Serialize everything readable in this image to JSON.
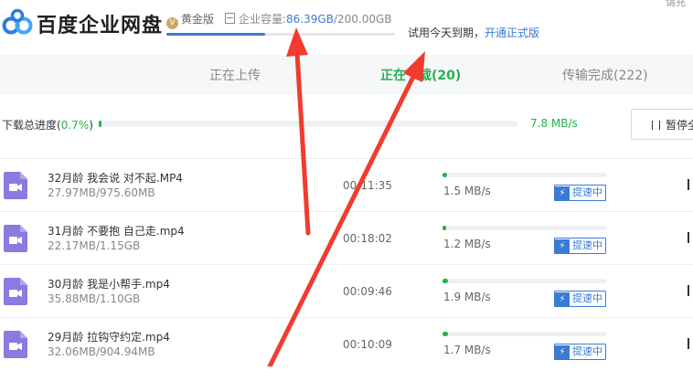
{
  "header": {
    "logo_text": "百度企业网盘",
    "plan_label": "黄金版",
    "storage_label": "企业容量:",
    "storage_used": "86.39GB",
    "storage_total": "/200.00GB",
    "storage_fraction": 0.432,
    "trial_text": "试用今天到期，",
    "upgrade_link": "开通正式版",
    "corner_text": "请充"
  },
  "tabs": [
    {
      "label": "正在上传"
    },
    {
      "label": "正在下载(20)"
    },
    {
      "label": "传输完成(222)"
    }
  ],
  "overall": {
    "label": "下载总进度(",
    "percent": "0.7%",
    "label_end": ")",
    "progress": 0.007,
    "speed": "7.8 MB/s",
    "pause_label": "暂停全"
  },
  "rows": [
    {
      "name": "32月龄 我会说 对不起.MP4",
      "size": "27.97MB/975.60MB",
      "time": "00:11:35",
      "speed": "1.5 MB/s",
      "boost": "提速中",
      "progress": 0.029
    },
    {
      "name": "31月龄 不要抱 自己走.mp4",
      "size": "22.17MB/1.15GB",
      "time": "00:18:02",
      "speed": "1.2 MB/s",
      "boost": "提速中",
      "progress": 0.019
    },
    {
      "name": "30月龄 我是小帮手.mp4",
      "size": "35.88MB/1.10GB",
      "time": "00:09:46",
      "speed": "1.9 MB/s",
      "boost": "提速中",
      "progress": 0.032
    },
    {
      "name": "29月龄 拉钩守约定.mp4",
      "size": "32.06MB/904.94MB",
      "time": "00:10:09",
      "speed": "1.7 MB/s",
      "boost": "提速中",
      "progress": 0.035
    }
  ],
  "colors": {
    "accent_green": "#22b14c",
    "accent_blue": "#3a7bd5",
    "video_icon": "#8b7be0",
    "annotation_red": "#f23b2e"
  }
}
